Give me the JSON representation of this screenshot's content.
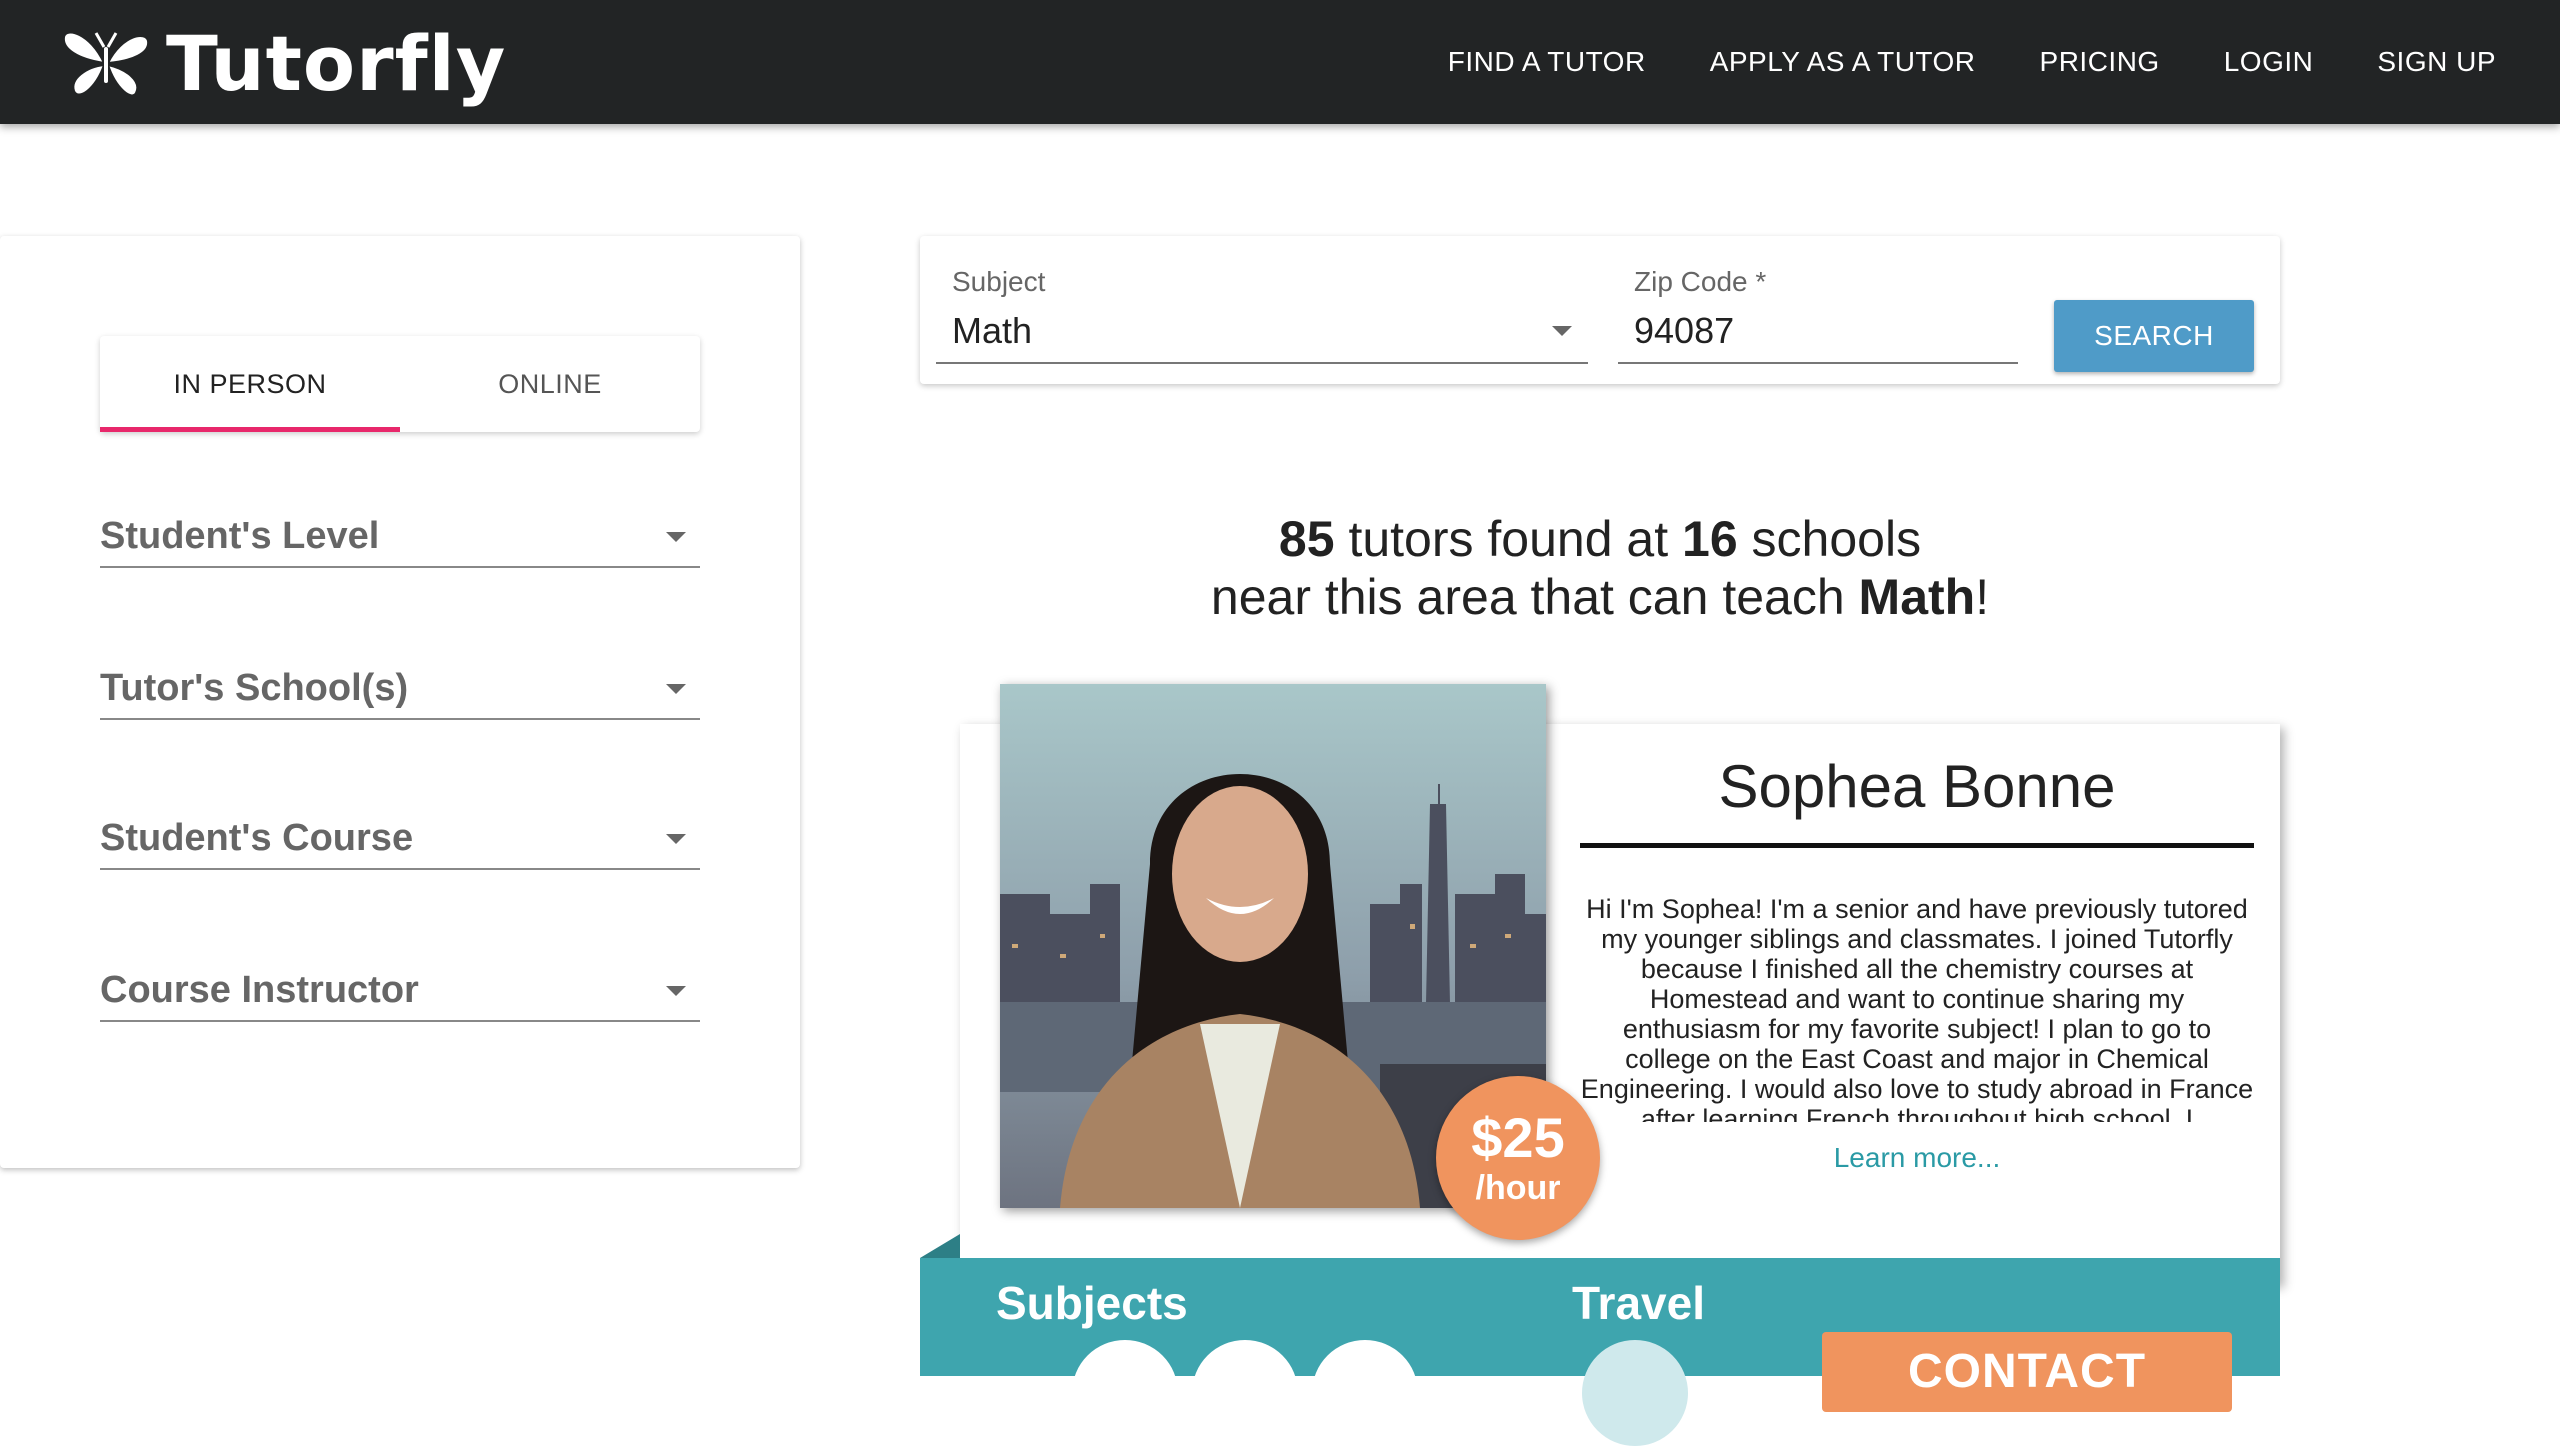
{
  "nav": {
    "brand": "Tutorfly",
    "links": [
      "FIND A TUTOR",
      "APPLY AS A TUTOR",
      "PRICING",
      "LOGIN",
      "SIGN UP"
    ]
  },
  "filters": {
    "tabs": [
      "IN PERSON",
      "ONLINE"
    ],
    "active_tab": "IN PERSON",
    "selects": [
      "Student's Level",
      "Tutor's School(s)",
      "Student's Course",
      "Course Instructor"
    ]
  },
  "search": {
    "subject_label": "Subject",
    "subject_value": "Math",
    "zip_label": "Zip Code *",
    "zip_value": "94087",
    "button": "SEARCH"
  },
  "results": {
    "tutor_count": "85",
    "text_1": "tutors found at",
    "school_count": "16",
    "text_2": "schools",
    "text_3": "near this area that can teach",
    "subject": "Math",
    "text_4": "!"
  },
  "tutor": {
    "name": "Sophea Bonne",
    "price": "$25",
    "price_unit": "/hour",
    "bio": "Hi I'm Sophea! I'm a senior and have previously tutored my younger siblings and classmates. I joined Tutorfly because I finished all the chemistry courses at Homestead and want to continue sharing my enthusiasm for my favorite subject! I plan to go to college on the East Coast and major in Chemical Engineering. I would also love to study abroad in France after learning French throughout high school. I",
    "learn_more": "Learn more...",
    "subjects_title": "Subjects",
    "travel_title": "Travel",
    "contact": "CONTACT"
  },
  "colors": {
    "nav_bg": "#222425",
    "tab_accent": "#e8286b",
    "search_button": "#4f9bc8",
    "teal": "#3ea5ae",
    "orange": "#f0945e"
  }
}
